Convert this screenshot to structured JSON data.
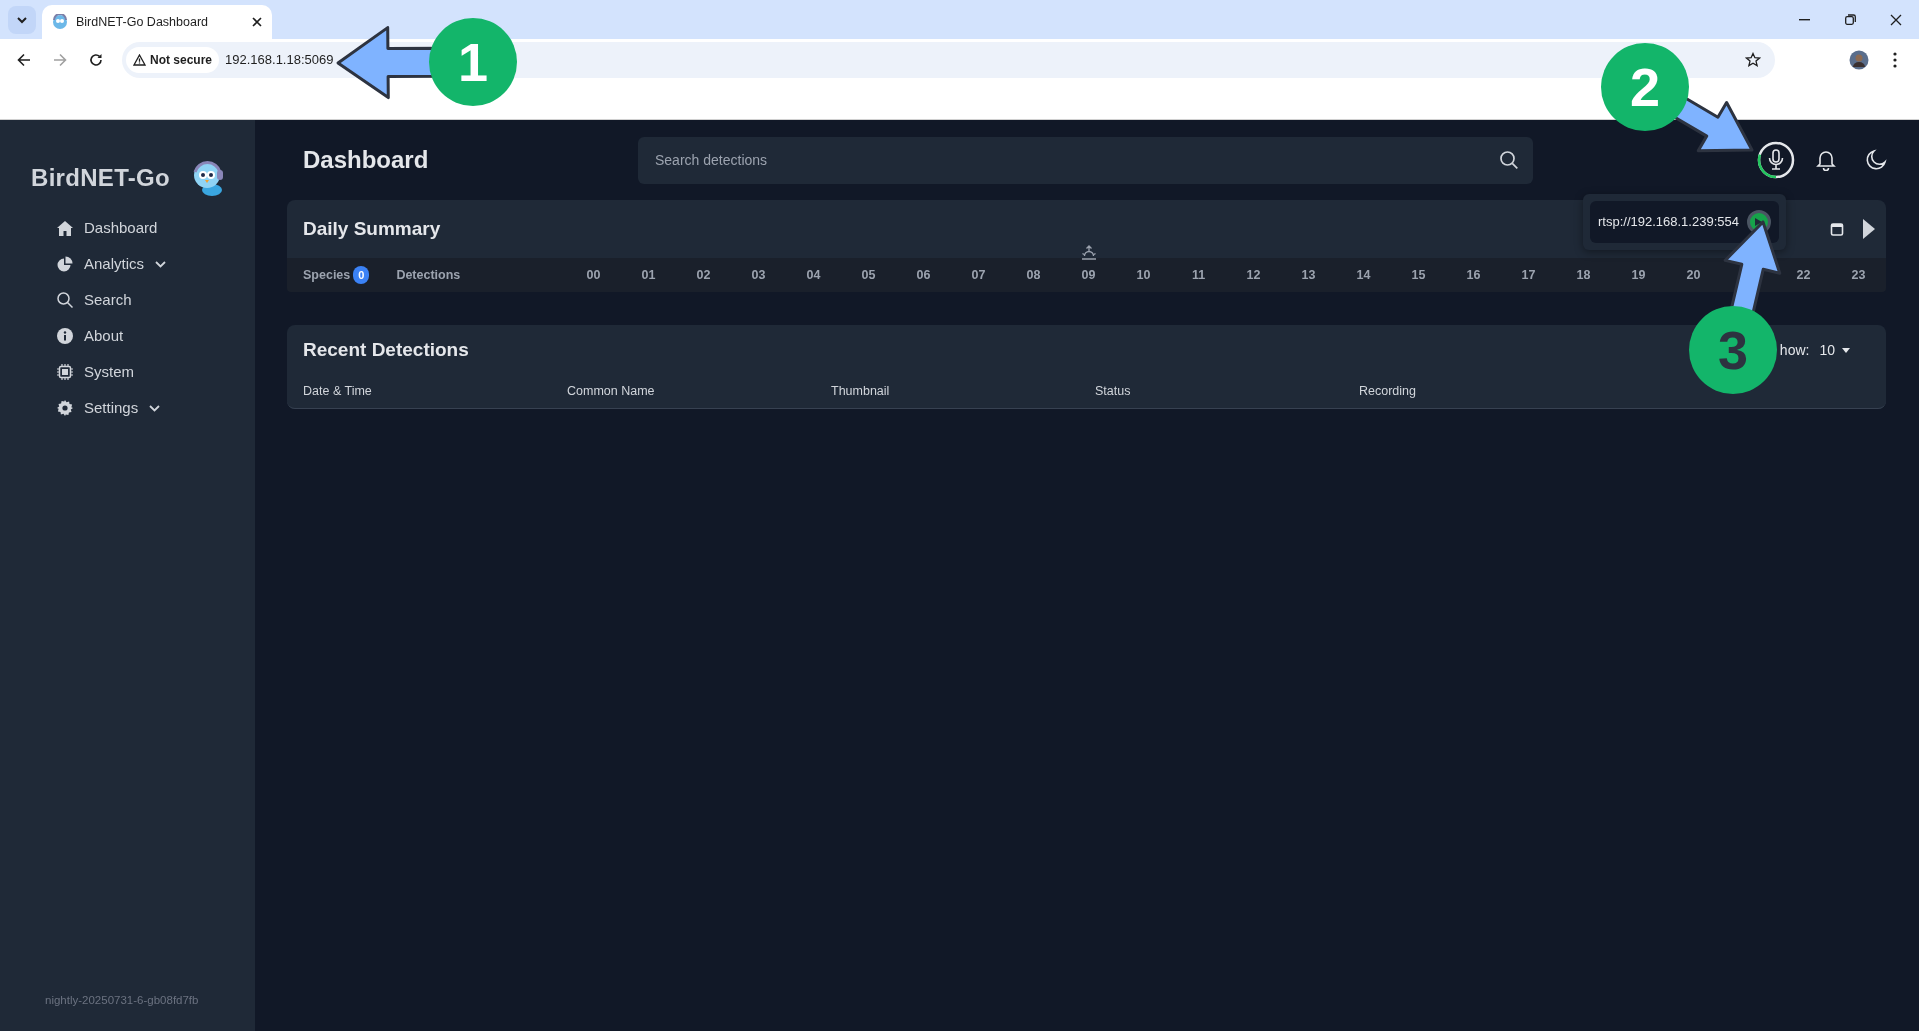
{
  "browser": {
    "tab_title": "BirdNET-Go Dashboard",
    "security_label": "Not secure",
    "url": "192.168.1.18:5069"
  },
  "sidebar": {
    "brand": "BirdNET-Go",
    "items": [
      {
        "label": "Dashboard",
        "kind": "home",
        "expandable": false
      },
      {
        "label": "Analytics",
        "kind": "chart",
        "expandable": true
      },
      {
        "label": "Search",
        "kind": "search",
        "expandable": false
      },
      {
        "label": "About",
        "kind": "info",
        "expandable": false
      },
      {
        "label": "System",
        "kind": "chip",
        "expandable": false
      },
      {
        "label": "Settings",
        "kind": "gear",
        "expandable": true
      }
    ],
    "version": "nightly-20250731-6-gb08fd7fb"
  },
  "header": {
    "title": "Dashboard",
    "search": {
      "placeholder": "Search detections"
    }
  },
  "audio_source": {
    "url": "rtsp://192.168.1.239:554"
  },
  "daily_summary": {
    "title": "Daily Summary",
    "species_label": "Species",
    "species_count": "0",
    "detections_label": "Detections",
    "hours": [
      {
        "label": "00",
        "sunrise": false
      },
      {
        "label": "01",
        "sunrise": false
      },
      {
        "label": "02",
        "sunrise": false
      },
      {
        "label": "03",
        "sunrise": false
      },
      {
        "label": "04",
        "sunrise": false
      },
      {
        "label": "05",
        "sunrise": false
      },
      {
        "label": "06",
        "sunrise": false
      },
      {
        "label": "07",
        "sunrise": false
      },
      {
        "label": "08",
        "sunrise": false
      },
      {
        "label": "09",
        "sunrise": true
      },
      {
        "label": "10",
        "sunrise": false
      },
      {
        "label": "11",
        "sunrise": false
      },
      {
        "label": "12",
        "sunrise": false
      },
      {
        "label": "13",
        "sunrise": false
      },
      {
        "label": "14",
        "sunrise": false
      },
      {
        "label": "15",
        "sunrise": false
      },
      {
        "label": "16",
        "sunrise": false
      },
      {
        "label": "17",
        "sunrise": false
      },
      {
        "label": "18",
        "sunrise": false
      },
      {
        "label": "19",
        "sunrise": false
      },
      {
        "label": "20",
        "sunrise": false
      }
    ],
    "late_hours": [
      {
        "label": "22"
      },
      {
        "label": "23"
      }
    ]
  },
  "recent": {
    "title": "Recent Detections",
    "show_label": "how:",
    "show_value": "10",
    "columns": [
      "Date & Time",
      "Common Name",
      "Thumbnail",
      "Status",
      "Recording"
    ]
  },
  "annotations": [
    {
      "number": "1"
    },
    {
      "number": "2"
    },
    {
      "number": "3"
    }
  ]
}
